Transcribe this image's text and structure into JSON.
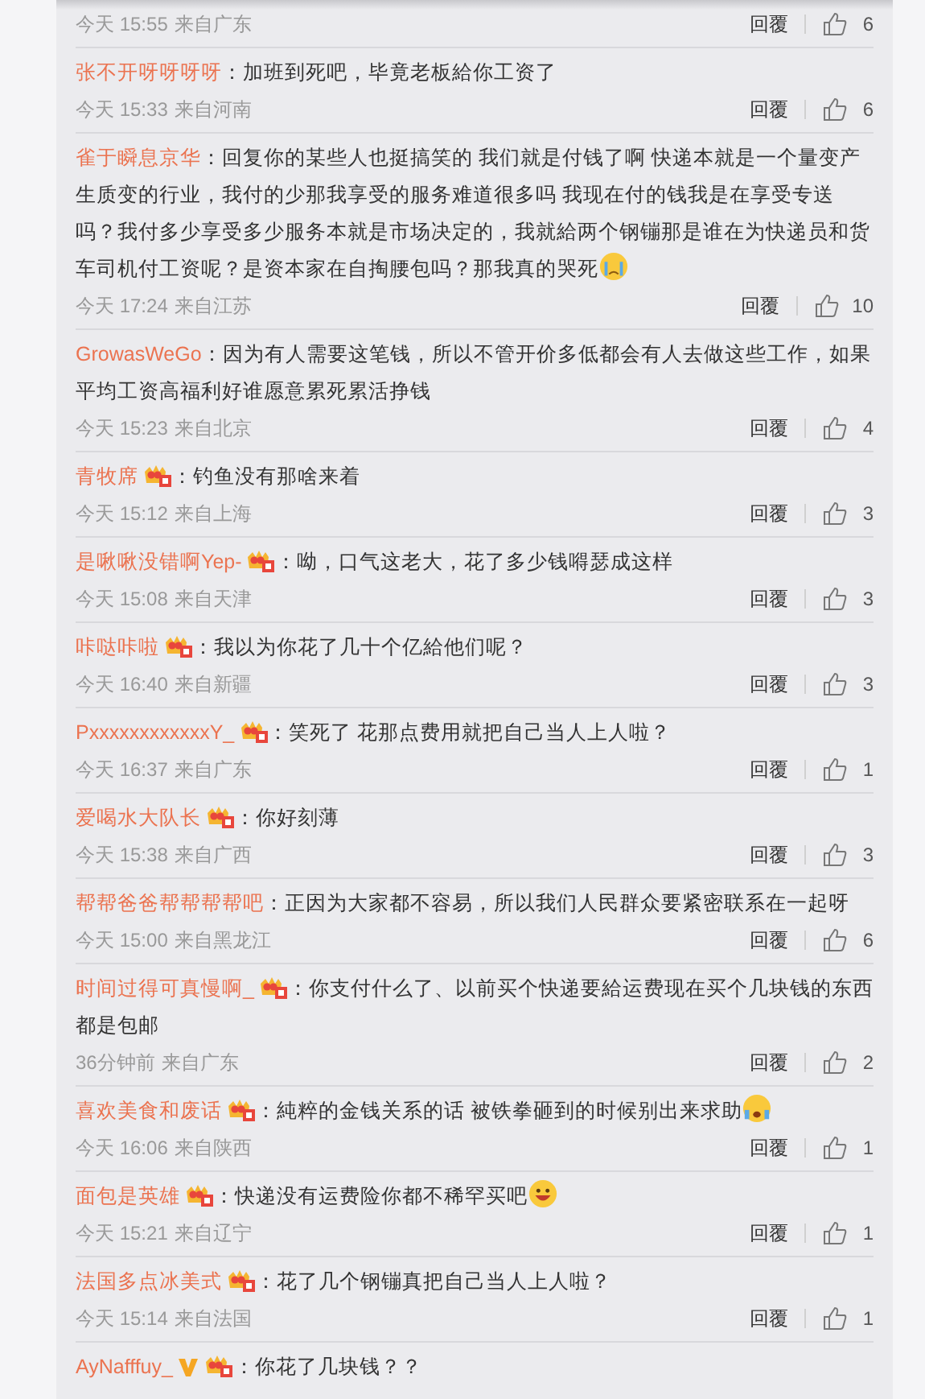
{
  "comments": [
    {
      "time": "今天 15:55",
      "location": "来自广东",
      "reply": "回覆",
      "likes": "6"
    },
    {
      "user": "张不开呀呀呀呀",
      "text": "：加班到死吧，毕竟老板給你工资了",
      "time": "今天 15:33",
      "location": "来自河南",
      "reply": "回覆",
      "likes": "6"
    },
    {
      "user": "雀于瞬息京华",
      "text": "：回复你的某些人也挺搞笑的 我们就是付钱了啊 快递本就是一个量变产生质变的行业，我付的少那我享受的服务难道很多吗 我现在付的钱我是在享受专送吗？我付多少享受多少服务本就是市场决定的，我就給两个钢镚那是谁在为快递员和货车司机付工资呢？是资本家在自掏腰包吗？那我真的哭死",
      "emoji": {
        "kind": "crying"
      },
      "time": "今天 17:24",
      "location": "来自江苏",
      "reply": "回覆",
      "likes": "10"
    },
    {
      "user": "GrowasWeGo",
      "text": "：因为有人需要这笔钱，所以不管开价多低都会有人去做这些工作，如果平均工资高福利好谁愿意累死累活挣钱",
      "time": "今天 15:23",
      "location": "来自北京",
      "reply": "回覆",
      "likes": "4"
    },
    {
      "user": "青牧席",
      "badges": [
        {
          "kind": "level"
        }
      ],
      "text": "：钓鱼没有那啥来着",
      "time": "今天 15:12",
      "location": "来自上海",
      "reply": "回覆",
      "likes": "3"
    },
    {
      "user": "是啾啾没错啊Yep-",
      "badges": [
        {
          "kind": "level"
        }
      ],
      "text": "：呦，口气这老大，花了多少钱嘚瑟成这样",
      "time": "今天 15:08",
      "location": "来自天津",
      "reply": "回覆",
      "likes": "3"
    },
    {
      "user": "咔哒咔啦",
      "badges": [
        {
          "kind": "level"
        }
      ],
      "text": "：我以为你花了几十个亿給他们呢？",
      "time": "今天 16:40",
      "location": "来自新疆",
      "reply": "回覆",
      "likes": "3"
    },
    {
      "user": "PxxxxxxxxxxxxY_",
      "badges": [
        {
          "kind": "level"
        }
      ],
      "text": "：笑死了 花那点费用就把自己当人上人啦？",
      "time": "今天 16:37",
      "location": "来自广东",
      "reply": "回覆",
      "likes": "1"
    },
    {
      "user": "爱喝水大队长",
      "badges": [
        {
          "kind": "level"
        }
      ],
      "text": "：你好刻薄",
      "time": "今天 15:38",
      "location": "来自广西",
      "reply": "回覆",
      "likes": "3"
    },
    {
      "user": "帮帮爸爸帮帮帮帮吧",
      "text": "：正因为大家都不容易，所以我们人民群众要紧密联系在一起呀",
      "time": "今天 15:00",
      "location": "来自黑龙江",
      "reply": "回覆",
      "likes": "6"
    },
    {
      "user": "时间过得可真慢啊_",
      "badges": [
        {
          "kind": "level"
        }
      ],
      "text": "：你支付什么了、以前买个快递要給运费现在买个几块钱的东西都是包邮",
      "time": "36分钟前",
      "location": "来自广东",
      "reply": "回覆",
      "likes": "2"
    },
    {
      "user": "喜欢美食和废话",
      "badges": [
        {
          "kind": "level"
        }
      ],
      "text": "：純粹的金钱关系的话 被铁拳砸到的时候别出来求助",
      "emoji": {
        "kind": "scared"
      },
      "time": "今天 16:06",
      "location": "来自陕西",
      "reply": "回覆",
      "likes": "1"
    },
    {
      "user": "面包是英雄",
      "badges": [
        {
          "kind": "level"
        }
      ],
      "text": "：快递没有运费险你都不稀罕买吧",
      "emoji": {
        "kind": "grin"
      },
      "time": "今天 15:21",
      "location": "来自辽宁",
      "reply": "回覆",
      "likes": "1"
    },
    {
      "user": "法国多点冰美式",
      "badges": [
        {
          "kind": "level"
        }
      ],
      "text": "：花了几个钢镚真把自己当人上人啦？",
      "time": "今天 15:14",
      "location": "来自法国",
      "reply": "回覆",
      "likes": "1"
    },
    {
      "user": "AyNafffuy_",
      "badges": [
        {
          "kind": "vip"
        },
        {
          "kind": "level"
        }
      ],
      "text": "：你花了几块钱？？"
    }
  ]
}
